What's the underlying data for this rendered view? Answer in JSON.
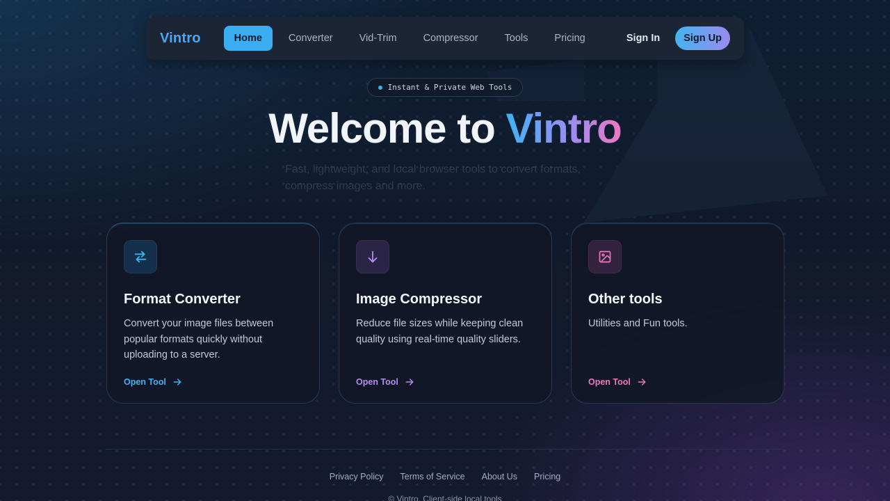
{
  "nav": {
    "brand": "Vintro",
    "items": [
      {
        "label": "Home",
        "active": true
      },
      {
        "label": "Converter"
      },
      {
        "label": "Vid-Trim"
      },
      {
        "label": "Compressor"
      },
      {
        "label": "Tools"
      },
      {
        "label": "Pricing"
      }
    ],
    "sign_in": "Sign In",
    "sign_up": "Sign Up"
  },
  "hero": {
    "pill": "Instant & Private Web Tools",
    "title_prefix": "Welcome to ",
    "title_highlight": "Vintro",
    "subtitle": "Fast, lightweight, and local browser tools to convert formats, compress images and more."
  },
  "cards": [
    {
      "icon": "swap-arrows-icon",
      "title": "Format Converter",
      "description": "Convert your image files between popular formats quickly without uploading to a server.",
      "link": "Open Tool",
      "accent": "#3fb2f5"
    },
    {
      "icon": "arrow-down-icon",
      "title": "Image Compressor",
      "description": "Reduce file sizes while keeping clean quality using real-time quality sliders.",
      "link": "Open Tool",
      "accent": "#b58cf0"
    },
    {
      "icon": "image-icon",
      "title": "Other tools",
      "description": "Utilities and Fun tools.",
      "link": "Open Tool",
      "accent": "#ee78c0"
    }
  ],
  "footer": {
    "links": [
      "Privacy Policy",
      "Terms of Service",
      "About Us",
      "Pricing"
    ],
    "copyright": "© Vintro. Client-side local tools"
  }
}
